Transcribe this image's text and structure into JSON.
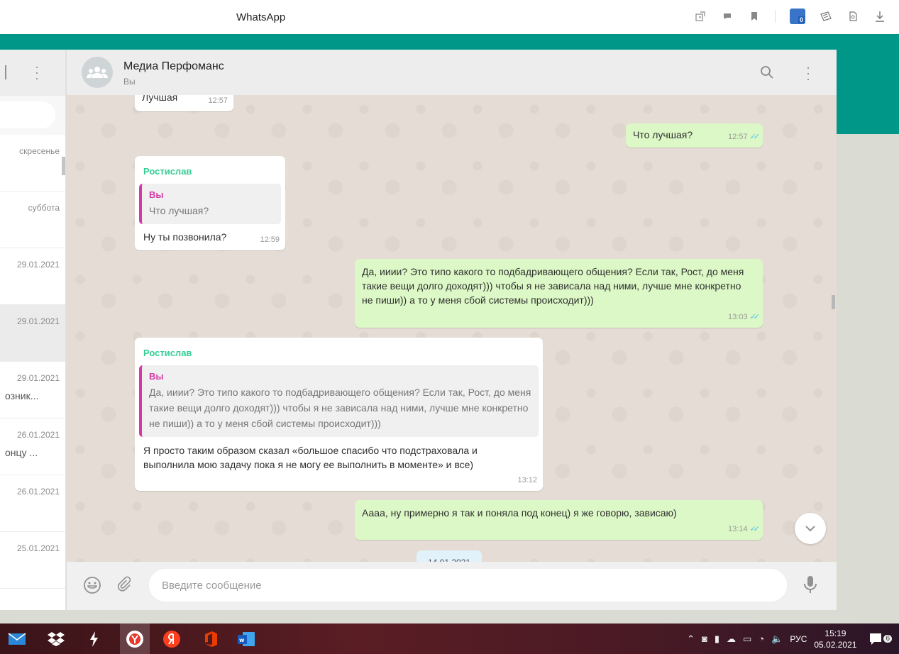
{
  "browser": {
    "title": "WhatsApp"
  },
  "sidebar": {
    "chats": [
      {
        "date": "скресенье",
        "snippet": ""
      },
      {
        "date": "суббота",
        "snippet": ""
      },
      {
        "date": "29.01.2021",
        "snippet": ""
      },
      {
        "date": "29.01.2021",
        "snippet": ""
      },
      {
        "date": "29.01.2021",
        "snippet": "озник..."
      },
      {
        "date": "26.01.2021",
        "snippet": "онцу ..."
      },
      {
        "date": "26.01.2021",
        "snippet": ""
      },
      {
        "date": "25.01.2021",
        "snippet": ""
      }
    ]
  },
  "chat": {
    "name": "Медиа Перфоманс",
    "subtitle": "Вы",
    "messages": [
      {
        "text": "Лучшая",
        "time": "12:57"
      },
      {
        "text": "Что лучшая?",
        "time": "12:57"
      },
      {
        "sender": "Ростислав",
        "quote_name": "Вы",
        "quote_text": "Что лучшая?",
        "text": "Ну ты позвонила?",
        "time": "12:59"
      },
      {
        "text": "Да, ииии? Это типо какого то подбадривающего общения? Если так, Рост, до меня такие вещи долго доходят))) чтобы я не зависала над ними, лучше мне конкретно не пиши)) а то у меня сбой системы происходит)))",
        "time": "13:03"
      },
      {
        "sender": "Ростислав",
        "quote_name": "Вы",
        "quote_text": "Да, ииии? Это типо какого то подбадривающего общения? Если так, Рост, до меня такие вещи долго доходят))) чтобы я не зависала над ними, лучше мне конкретно не пиши)) а то у меня сбой системы происходит)))",
        "text": "Я просто таким образом сказал «большое спасибо что подстраховала и выполнила мою задачу пока я не могу ее выполнить в моменте» и все)",
        "time": "13:12"
      },
      {
        "text": "Аааа, ну примерно я так и поняла под конец) я же говорю, зависаю)",
        "time": "13:14"
      }
    ],
    "date_chip": "14.01.2021"
  },
  "composer": {
    "placeholder": "Введите сообщение"
  },
  "taskbar": {
    "tray_lang": "РУС",
    "time": "15:19",
    "date": "05.02.2021",
    "notif_count": "6"
  },
  "colors": {
    "accent": "#009688",
    "outgoing": "#dcf8c6",
    "sender": "#35cd96",
    "quote_bar": "#d43aa5"
  }
}
